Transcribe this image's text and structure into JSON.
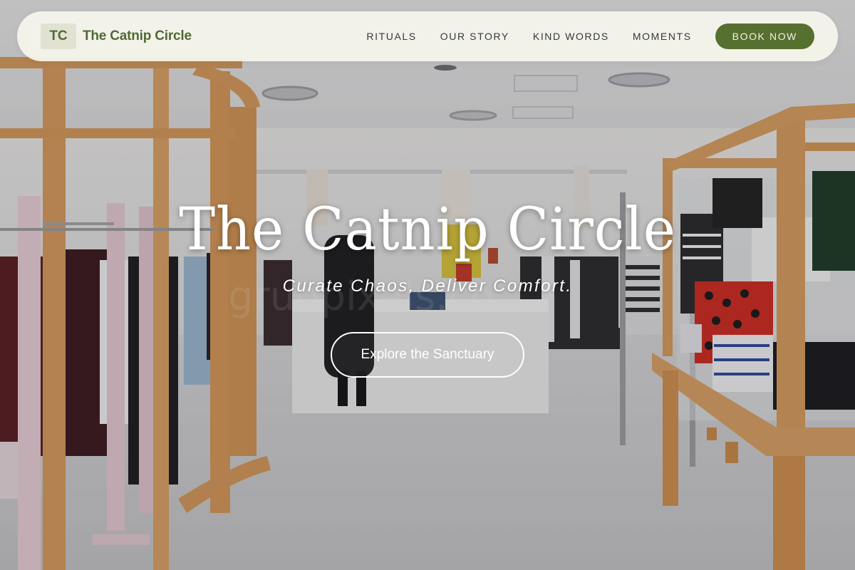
{
  "brand": {
    "mark": "TC",
    "name": "The Catnip Circle"
  },
  "nav": {
    "items": [
      {
        "label": "RITUALS"
      },
      {
        "label": "OUR STORY"
      },
      {
        "label": "KIND WORDS"
      },
      {
        "label": "MOMENTS"
      }
    ],
    "cta_label": "BOOK NOW"
  },
  "hero": {
    "title": "The Catnip Circle",
    "tagline": "Curate Chaos, Deliver Comfort.",
    "cta_label": "Explore the Sanctuary"
  },
  "colors": {
    "brand_green": "#56702f",
    "nav_background": "#f6f5ec",
    "brand_text": "#4e6a34"
  }
}
